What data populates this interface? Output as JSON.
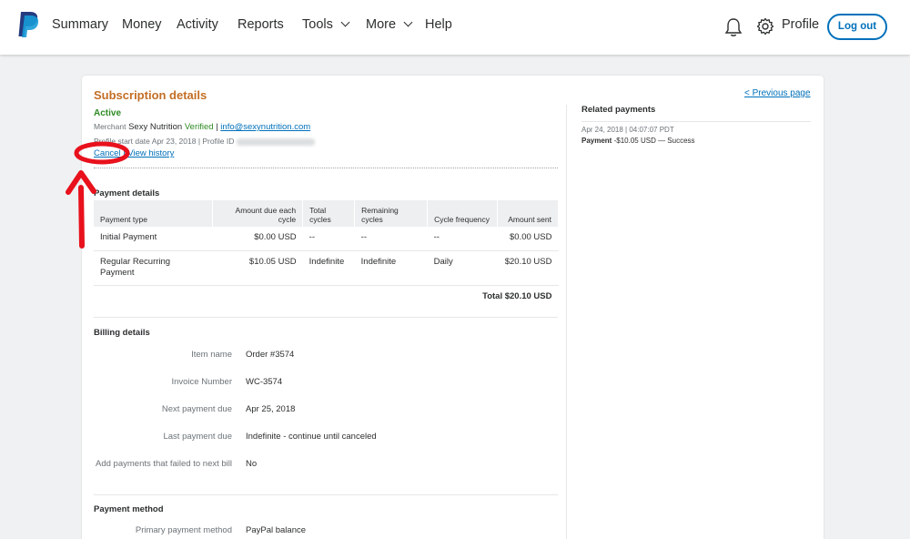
{
  "header": {
    "nav": [
      "Summary",
      "Money",
      "Activity",
      "Reports",
      "Tools",
      "More",
      "Help"
    ],
    "profile_label": "Profile",
    "logout_label": "Log out"
  },
  "colors": {
    "brand_blue": "#0070ba",
    "title_orange": "#c36e25",
    "status_green": "#2e8a23",
    "annotation_red": "#e8111c"
  },
  "subscription": {
    "title": "Subscription details",
    "previous_link": "< Previous page",
    "status": "Active",
    "merchant_label": "Merchant",
    "merchant_name": "Sexy Nutrition",
    "verified": "Verified",
    "separator": "|",
    "email": "info@sexynutrition.com",
    "profile_start": "Profile start date Apr 23, 2018 | Profile ID",
    "cancel_link": "Cancel",
    "history_link": "View history"
  },
  "payment_details": {
    "heading": "Payment details",
    "columns": [
      "Payment type",
      "Amount due each cycle",
      "Total cycles",
      "Remaining cycles",
      "Cycle frequency",
      "Amount sent"
    ],
    "rows": [
      [
        "Initial Payment",
        "$0.00 USD",
        "--",
        "--",
        "--",
        "$0.00 USD"
      ],
      [
        "Regular Recurring Payment",
        "$10.05 USD",
        "Indefinite",
        "Indefinite",
        "Daily",
        "$20.10 USD"
      ]
    ],
    "total": "Total $20.10 USD"
  },
  "billing": {
    "heading": "Billing details",
    "rows": [
      {
        "label": "Item name",
        "value": "Order #3574"
      },
      {
        "label": "Invoice Number",
        "value": "WC-3574"
      },
      {
        "label": "Next payment due",
        "value": "Apr 25, 2018"
      },
      {
        "label": "Last payment due",
        "value": "Indefinite - continue until canceled"
      },
      {
        "label": "Add payments that failed to next bill",
        "value": "No"
      }
    ]
  },
  "payment_method": {
    "heading": "Payment method",
    "label": "Primary payment method",
    "value": "PayPal balance"
  },
  "related": {
    "title": "Related payments",
    "date": "Apr 24, 2018 | 04:07:07 PDT",
    "payment_label": "Payment",
    "payment_detail": "-$10.05 USD — Success"
  }
}
